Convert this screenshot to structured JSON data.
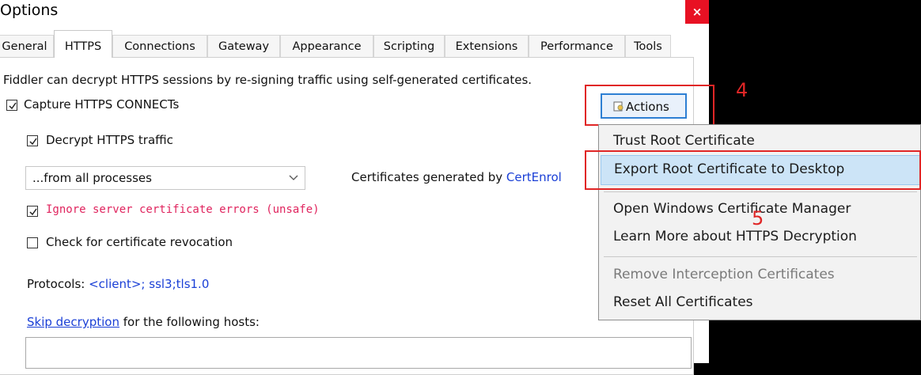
{
  "window": {
    "title": "Options",
    "close_label": "×"
  },
  "tabs": [
    {
      "label": "General"
    },
    {
      "label": "HTTPS"
    },
    {
      "label": "Connections"
    },
    {
      "label": "Gateway"
    },
    {
      "label": "Appearance"
    },
    {
      "label": "Scripting"
    },
    {
      "label": "Extensions"
    },
    {
      "label": "Performance"
    },
    {
      "label": "Tools"
    }
  ],
  "https": {
    "intro": "Fiddler can decrypt HTTPS sessions by re-signing traffic using self-generated certificates.",
    "capture_label": "Capture HTTPS CONNECTs",
    "capture_checked": true,
    "decrypt_label": "Decrypt HTTPS traffic",
    "decrypt_checked": true,
    "process_filter": "...from all processes",
    "cert_gen_prefix": "Certificates generated by ",
    "cert_gen_link": "CertEnrol",
    "ignore_errors_label": "Ignore server certificate errors (unsafe)",
    "ignore_errors_checked": true,
    "revocation_label": "Check for certificate revocation",
    "revocation_checked": false,
    "protocols_label": "Protocols: ",
    "protocols_value": "<client>; ssl3;tls1.0",
    "skip_link": "Skip decryption",
    "skip_suffix": " for the following hosts:",
    "actions_label": "Actions"
  },
  "actions_menu": [
    {
      "label": "Trust Root Certificate",
      "highlighted": false,
      "disabled": false
    },
    {
      "label": "Export Root Certificate to Desktop",
      "highlighted": true,
      "disabled": false
    },
    {
      "label": "Open Windows Certificate Manager",
      "highlighted": false,
      "disabled": false
    },
    {
      "label": "Learn More about HTTPS Decryption",
      "highlighted": false,
      "disabled": false
    },
    {
      "label": "Remove Interception Certificates",
      "highlighted": false,
      "disabled": true
    },
    {
      "label": "Reset All Certificates",
      "highlighted": false,
      "disabled": false
    }
  ],
  "annotations": {
    "step4": "4",
    "step5": "5"
  },
  "colors": {
    "annotation_red": "#e02626",
    "link_blue": "#1a3fd6",
    "warning_red": "#e0245e",
    "menu_highlight": "#cce4f7"
  }
}
